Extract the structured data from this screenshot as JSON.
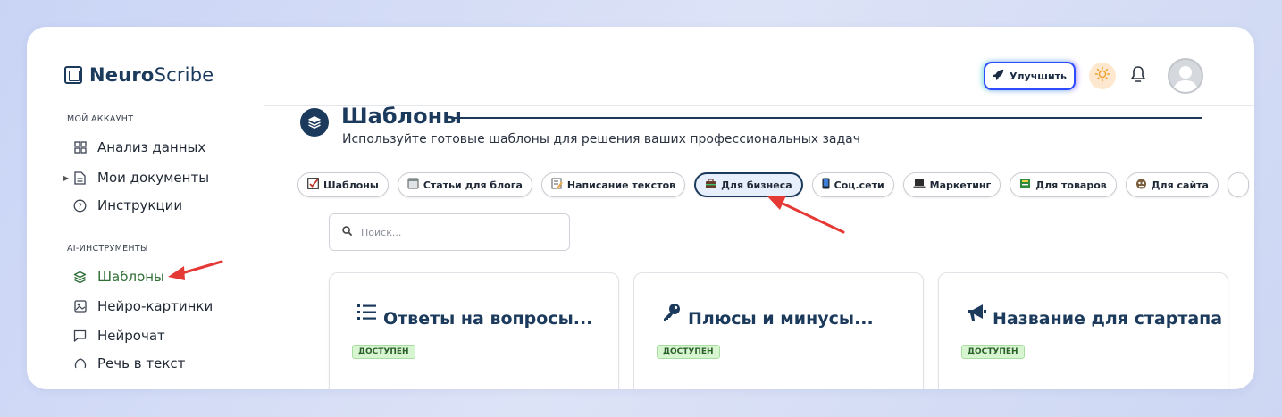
{
  "brand": {
    "name_bold": "Neuro",
    "name_rest": "Scribe"
  },
  "header": {
    "upgrade_label": "Улучшить",
    "theme_icon": "sun-icon",
    "bell_icon": "bell-icon"
  },
  "sidebar": {
    "section_account": "МОЙ АККАУНТ",
    "section_ai": "AI-ИНСТРУМЕНТЫ",
    "items": [
      {
        "label": "Анализ данных",
        "icon": "grid-icon"
      },
      {
        "label": "Мои документы",
        "icon": "document-icon"
      },
      {
        "label": "Инструкции",
        "icon": "help-icon"
      },
      {
        "label": "Шаблоны",
        "icon": "layers-icon",
        "active": true
      },
      {
        "label": "Нейро-картинки",
        "icon": "image-icon"
      },
      {
        "label": "Нейрочат",
        "icon": "chat-icon"
      },
      {
        "label": "Речь в текст",
        "icon": "speech-icon"
      }
    ]
  },
  "main": {
    "title": "Шаблоны",
    "subtitle": "Используйте готовые шаблоны для решения ваших профессиональных задач",
    "chips": [
      {
        "label": "Шаблоны",
        "color": "#c0392b"
      },
      {
        "label": "Статьи для блога",
        "color": "#7f8c8d"
      },
      {
        "label": "Написание текстов",
        "color": "#e6a84a"
      },
      {
        "label": "Для бизнеса",
        "color": "#6a3d2a",
        "active": true
      },
      {
        "label": "Соц.сети",
        "color": "#1c2530"
      },
      {
        "label": "Маркетинг",
        "color": "#2c2c2c"
      },
      {
        "label": "Для товаров",
        "color": "#2e8b3d"
      },
      {
        "label": "Для сайта",
        "color": "#7a5c3a"
      }
    ],
    "search_placeholder": "Поиск...",
    "cards": [
      {
        "title": "Ответы на вопросы...",
        "badge": "ДОСТУПЕН",
        "icon": "list-icon"
      },
      {
        "title": "Плюсы и минусы...",
        "badge": "ДОСТУПЕН",
        "icon": "key-icon"
      },
      {
        "title": "Название для стартапа",
        "badge": "ДОСТУПЕН",
        "icon": "megaphone-icon"
      }
    ]
  },
  "colors": {
    "brand": "#1b3a5c",
    "active_green": "#2f6e34",
    "badge_bg": "#d8f5d2",
    "arrow": "#e53935"
  }
}
